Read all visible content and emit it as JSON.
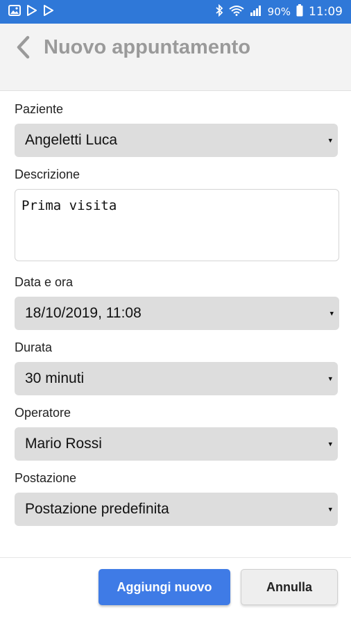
{
  "status_bar": {
    "left_icons": [
      "image-icon",
      "play-store-icon",
      "play-store-icon"
    ],
    "right_icons": [
      "bluetooth-icon",
      "wifi-icon",
      "signal-icon",
      "battery-icon"
    ],
    "battery": "90%",
    "time": "11:09",
    "bar_color": "#2f78d8"
  },
  "header": {
    "title": "Nuovo appuntamento",
    "back_icon": "chevron-left-icon"
  },
  "form": {
    "patient": {
      "label": "Paziente",
      "value": "Angeletti Luca"
    },
    "description": {
      "label": "Descrizione",
      "value": "Prima visita"
    },
    "datetime": {
      "label": "Data e ora",
      "value": "18/10/2019, 11:08"
    },
    "duration": {
      "label": "Durata",
      "value": "30 minuti"
    },
    "operator": {
      "label": "Operatore",
      "value": "Mario Rossi"
    },
    "station": {
      "label": "Postazione",
      "value": "Postazione predefinita"
    },
    "dropdown_arrow": "▾"
  },
  "actions": {
    "add_label": "Aggiungi nuovo",
    "cancel_label": "Annulla",
    "primary_color": "#3f7be6"
  }
}
